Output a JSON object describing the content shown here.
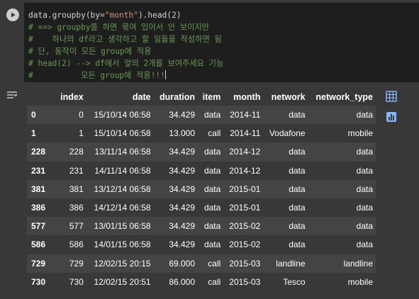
{
  "code": {
    "lines": [
      [
        {
          "t": "default",
          "v": "data.groupby(by="
        },
        {
          "t": "string",
          "v": "\"month\""
        },
        {
          "t": "default",
          "v": ").head("
        },
        {
          "t": "number",
          "v": "2"
        },
        {
          "t": "default",
          "v": ")"
        }
      ],
      [
        {
          "t": "comment",
          "v": "# ==> groupby를 하면 묶여 있어서 안 보이지만"
        }
      ],
      [
        {
          "t": "comment",
          "v": "#    하나의 df라고 생각하고 할 일들을 작성하면 됨"
        }
      ],
      [
        {
          "t": "comment",
          "v": "# 단, 동작이 모든 group에 적용"
        }
      ],
      [
        {
          "t": "comment",
          "v": "# head(2) --> df에서 앞의 2개를 보여주세요 기능"
        }
      ],
      [
        {
          "t": "comment",
          "v": "#          모든 group에 적용!!!"
        }
      ]
    ]
  },
  "table": {
    "columns": [
      "",
      "index",
      "date",
      "duration",
      "item",
      "month",
      "network",
      "network_type"
    ],
    "rows": [
      {
        "label": "0",
        "cells": [
          "0",
          "15/10/14 06:58",
          "34.429",
          "data",
          "2014-11",
          "data",
          "data"
        ]
      },
      {
        "label": "1",
        "cells": [
          "1",
          "15/10/14 06:58",
          "13.000",
          "call",
          "2014-11",
          "Vodafone",
          "mobile"
        ]
      },
      {
        "label": "228",
        "cells": [
          "228",
          "13/11/14 06:58",
          "34.429",
          "data",
          "2014-12",
          "data",
          "data"
        ]
      },
      {
        "label": "231",
        "cells": [
          "231",
          "14/11/14 06:58",
          "34.429",
          "data",
          "2014-12",
          "data",
          "data"
        ]
      },
      {
        "label": "381",
        "cells": [
          "381",
          "13/12/14 06:58",
          "34.429",
          "data",
          "2015-01",
          "data",
          "data"
        ]
      },
      {
        "label": "386",
        "cells": [
          "386",
          "14/12/14 06:58",
          "34.429",
          "data",
          "2015-01",
          "data",
          "data"
        ]
      },
      {
        "label": "577",
        "cells": [
          "577",
          "13/01/15 06:58",
          "34.429",
          "data",
          "2015-02",
          "data",
          "data"
        ]
      },
      {
        "label": "586",
        "cells": [
          "586",
          "14/01/15 06:58",
          "34.429",
          "data",
          "2015-02",
          "data",
          "data"
        ]
      },
      {
        "label": "729",
        "cells": [
          "729",
          "12/02/15 20:15",
          "69.000",
          "call",
          "2015-03",
          "landline",
          "landline"
        ]
      },
      {
        "label": "730",
        "cells": [
          "730",
          "12/02/15 20:51",
          "86.000",
          "call",
          "2015-03",
          "Tesco",
          "mobile"
        ]
      }
    ]
  },
  "icons": {
    "run": "play-icon",
    "output_menu": "output-menu-icon",
    "table_view": "table-icon",
    "chart_suggest": "chart-icon"
  },
  "colors": {
    "background": "#383838",
    "editor": "#1e1e1e",
    "comment": "#6a9955",
    "string": "#ce9178",
    "number": "#b5cea8",
    "accent_icon": "#8ab4f8"
  }
}
